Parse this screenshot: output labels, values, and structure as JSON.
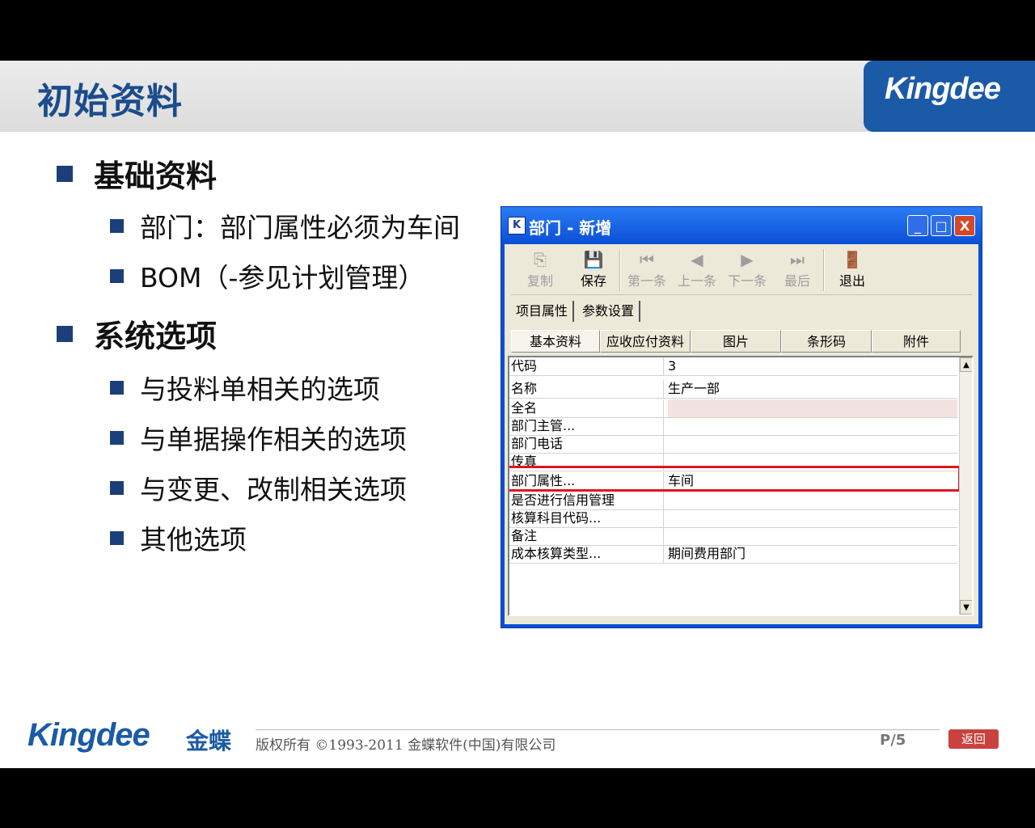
{
  "slide": {
    "title": "初始资料",
    "logo": "Kingdee",
    "bullets": [
      {
        "text": "基础资料",
        "level": 1
      },
      {
        "text": "部门：部门属性必须为车间",
        "level": 2
      },
      {
        "text": "BOM（-参见计划管理）",
        "level": 2
      },
      {
        "text": "系统选项",
        "level": 1
      },
      {
        "text": "与投料单相关的选项",
        "level": 2
      },
      {
        "text": "与单据操作相关的选项",
        "level": 2
      },
      {
        "text": "与变更、改制相关选项",
        "level": 2
      },
      {
        "text": "其他选项",
        "level": 2
      }
    ]
  },
  "dialog": {
    "title": "部门 - 新增",
    "icon_letter": "K",
    "window_buttons": {
      "minimize": "_",
      "maximize": "□",
      "close": "X"
    },
    "toolbar": [
      {
        "label": "复制",
        "icon": "copy-icon",
        "glyph": "⎘",
        "enabled": false
      },
      {
        "label": "保存",
        "icon": "save-icon",
        "glyph": "💾",
        "enabled": true
      },
      {
        "label": "第一条",
        "icon": "first-record-icon",
        "glyph": "⏮",
        "enabled": false
      },
      {
        "label": "上一条",
        "icon": "prev-record-icon",
        "glyph": "◀",
        "enabled": false
      },
      {
        "label": "下一条",
        "icon": "next-record-icon",
        "glyph": "▶",
        "enabled": false
      },
      {
        "label": "最后",
        "icon": "last-record-icon",
        "glyph": "⏭",
        "enabled": false
      },
      {
        "label": "退出",
        "icon": "exit-icon",
        "glyph": "🚪",
        "enabled": true
      }
    ],
    "top_tabs": [
      "项目属性",
      "参数设置"
    ],
    "sub_tabs": [
      "基本资料",
      "应收应付资料",
      "图片",
      "条形码",
      "附件"
    ],
    "active_sub_tab": "基本资料",
    "fields": [
      {
        "key": "代码",
        "value": "3"
      },
      {
        "key": "名称",
        "value": "生产一部"
      },
      {
        "key": "全名",
        "value": ""
      },
      {
        "key": "部门主管...",
        "value": ""
      },
      {
        "key": "部门电话",
        "value": ""
      },
      {
        "key": "传真",
        "value": ""
      },
      {
        "key": "部门属性...",
        "value": "车间"
      },
      {
        "key": "是否进行信用管理",
        "value": ""
      },
      {
        "key": "核算科目代码...",
        "value": ""
      },
      {
        "key": "备注",
        "value": ""
      },
      {
        "key": "成本核算类型...",
        "value": "期间费用部门"
      }
    ],
    "highlighted_field": "部门属性...",
    "highlight_color": "#e0141e"
  },
  "footer": {
    "logo": "Kingdee",
    "logo_cn": "金蝶",
    "copyright": "版权所有 ©1993-2011 金蝶软件(中国)有限公司",
    "page": "P/5",
    "back_button": "返回"
  }
}
